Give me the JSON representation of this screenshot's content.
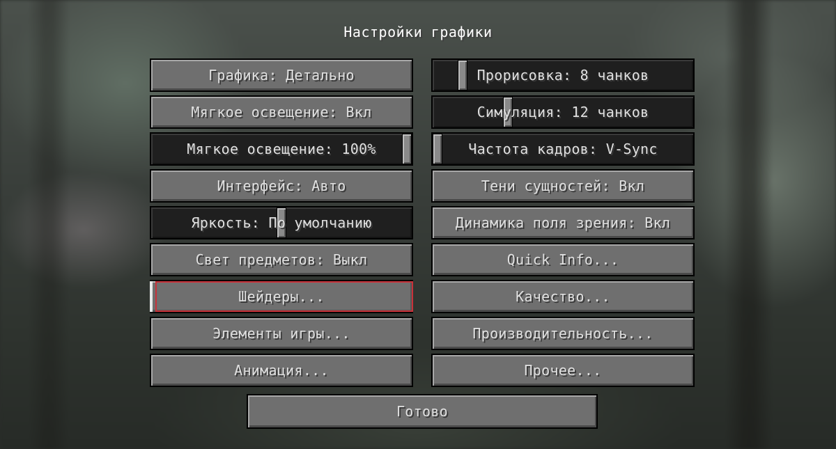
{
  "screen": {
    "title": "Настройки графики"
  },
  "left_column": [
    {
      "kind": "button",
      "label": "Графика: Детально"
    },
    {
      "kind": "button",
      "label": "Мягкое освещение: Вкл"
    },
    {
      "kind": "slider",
      "label": "Мягкое освещение: 100%",
      "level": 1.0
    },
    {
      "kind": "button",
      "label": "Интерфейс: Авто"
    },
    {
      "kind": "slider",
      "label": "Яркость: По умолчанию",
      "level": 0.5
    },
    {
      "kind": "button",
      "label": "Свет предметов: Выкл"
    },
    {
      "kind": "button",
      "label": "Шейдеры...",
      "highlighted": true
    },
    {
      "kind": "button",
      "label": "Элементы игры..."
    },
    {
      "kind": "button",
      "label": "Анимация..."
    }
  ],
  "right_column": [
    {
      "kind": "slider",
      "label": "Прорисовка: 8 чанков",
      "level": 0.1
    },
    {
      "kind": "slider",
      "label": "Симуляция: 12 чанков",
      "level": 0.28
    },
    {
      "kind": "slider",
      "label": "Частота кадров: V-Sync",
      "level": 0.0
    },
    {
      "kind": "button",
      "label": "Тени сущностей: Вкл"
    },
    {
      "kind": "button",
      "label": "Динамика поля зрения: Вкл"
    },
    {
      "kind": "button",
      "label": "Quick Info..."
    },
    {
      "kind": "button",
      "label": "Качество..."
    },
    {
      "kind": "button",
      "label": "Производительность..."
    },
    {
      "kind": "button",
      "label": "Прочее..."
    }
  ],
  "footer": {
    "done_label": "Готово"
  },
  "colors": {
    "button_face": "#6f6f6f",
    "slider_track": "#1f1f1f",
    "text": "#e0e0e0",
    "highlight_border": "#c9323a"
  }
}
